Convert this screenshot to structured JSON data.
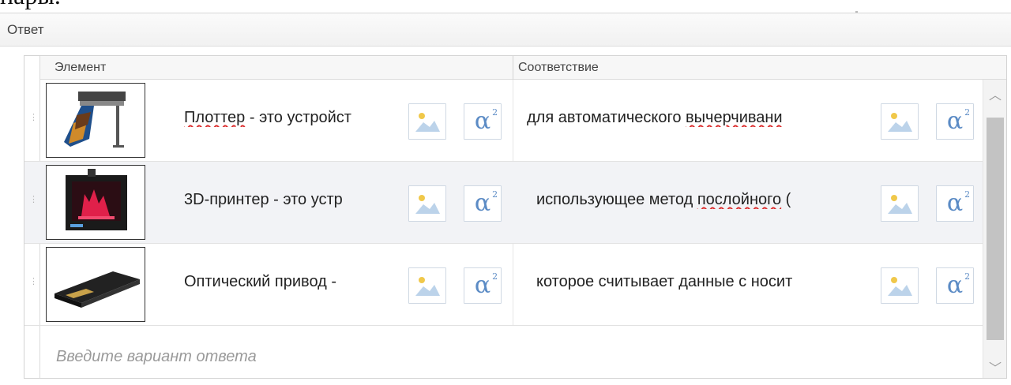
{
  "top_fragment": "пары.",
  "panel": {
    "title": "Ответ"
  },
  "grid": {
    "headers": {
      "element": "Элемент",
      "match": "Соответствие"
    },
    "rows": [
      {
        "thumbnail_icon": "plotter-image",
        "element_text": "Плоттер - это устройст",
        "element_prefix_misspelled": "Плоттер",
        "element_rest": " - это устройст",
        "match_prefix": "для автоматического ",
        "match_misspelled": "вычерчивани",
        "match_rest": ""
      },
      {
        "thumbnail_icon": "3d-printer-image",
        "element_text": "3D-принтер - это устр",
        "match_prefix": "использующее метод ",
        "match_misspelled": "послойного",
        "match_rest": " ("
      },
      {
        "thumbnail_icon": "optical-drive-image",
        "element_text": "Оптический привод - ",
        "match_text": "которое считывает данные с носит"
      }
    ],
    "placeholder": "Введите вариант ответа"
  },
  "icons": {
    "image_button": "image-icon",
    "formula_button": "alpha-squared-icon",
    "formula_glyph": "α",
    "formula_sup": "2",
    "drag_handle": "drag-handle-icon",
    "scroll_up": "chevron-up-icon",
    "scroll_down": "chevron-down-icon"
  },
  "colors": {
    "accent": "#5b8bc5",
    "row_alt": "#f2f3f6",
    "spellcheck": "#dd3333"
  }
}
